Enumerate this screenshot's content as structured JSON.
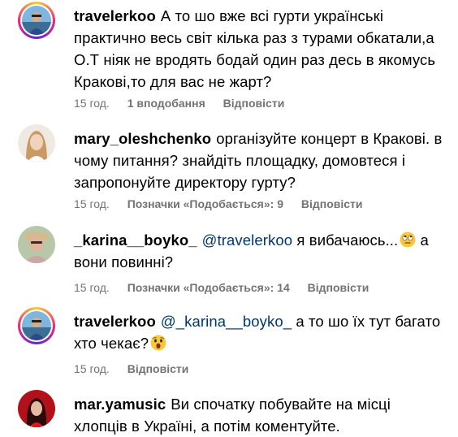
{
  "comments": [
    {
      "username": "travelerkoo",
      "text": "А то шо вже всі гурти українські практично весь світ кілька раз з турами обкатали,а О.Т ніяк не вродять бодай один раз десь в якомусь Кракові,то для вас не жарт?",
      "time": "15 год.",
      "likes": "1 вподобання",
      "reply": "Відповісти"
    },
    {
      "username": "mary_oleshchenko",
      "text": "організуйте концерт в Кракові. в чому питання? знайдіть площадку, домовтеся і запропонуйте директору гурту?",
      "time": "15 год.",
      "likes": "Позначки «Подобається»: 9",
      "reply": "Відповісти"
    },
    {
      "username": "_karina__boyko_",
      "mention": "@travelerkoo",
      "text": "я вибачаюсь...",
      "text_after": "а вони повинні?",
      "emoji": "face-with-rolling-eyes",
      "time": "15 год.",
      "likes": "Позначки «Подобається»: 14",
      "reply": "Відповісти"
    },
    {
      "username": "travelerkoo",
      "mention": "@_karina__boyko_",
      "text": "а то шо їх тут багато хто чекає?",
      "emoji": "astonished-face",
      "time": "15 год.",
      "reply": "Відповісти"
    },
    {
      "username": "mar.yamusic",
      "text": "Ви спочатку побувайте на місці хлопців в Україні, а потім коментуйте."
    }
  ]
}
